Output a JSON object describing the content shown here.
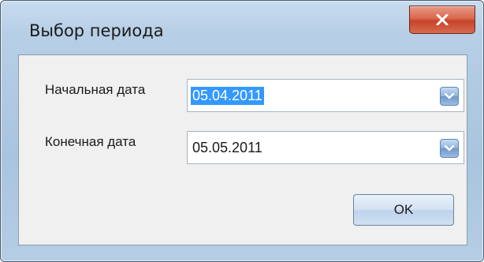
{
  "window": {
    "title": "Выбор периода"
  },
  "start_date": {
    "label": "Начальная дата",
    "value": "05.04.2011",
    "selected": true
  },
  "end_date": {
    "label": "Конечная дата",
    "value": "05.05.2011"
  },
  "buttons": {
    "ok_label": "OK"
  },
  "icons": {
    "close": "close-icon",
    "dropdown": "chevron-down-icon"
  },
  "colors": {
    "selection": "#3399ff",
    "close_button": "#c8432a",
    "titlebar": "#b7cfe6"
  }
}
